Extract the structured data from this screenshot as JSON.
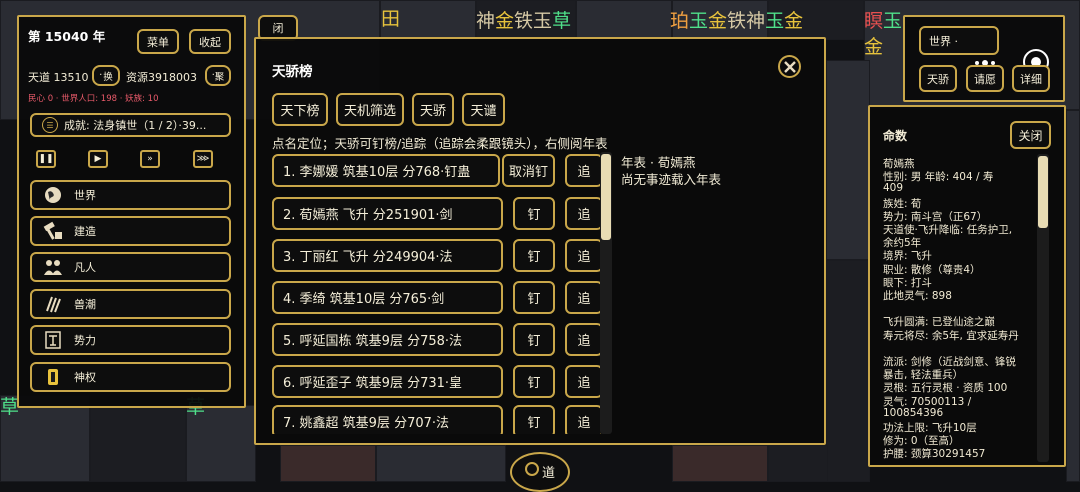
{
  "map": {
    "glyph_rows": [
      {
        "text": "神金铁玉草",
        "colors": [
          "#d5c8a4",
          "#e6c23c",
          "#d5c8a4",
          "#d5c8a4",
          "#4fe08a"
        ]
      },
      {
        "text": "珀玉金铁神玉金",
        "colors": [
          "#f0a040",
          "#4fe08a",
          "#e6c23c",
          "#d5c8a4",
          "#d5c8a4",
          "#4fe08a",
          "#e6c23c"
        ]
      },
      {
        "text": "田",
        "colors": [
          "#e6c23c"
        ]
      },
      {
        "text": "瞑玉",
        "colors": [
          "#e85050",
          "#4fe08a"
        ]
      },
      {
        "text": "金",
        "colors": [
          "#e6c23c"
        ]
      },
      {
        "text": "草",
        "colors": [
          "#4fe08a"
        ]
      }
    ],
    "colors": {
      "accent": "#c9a74a",
      "text": "#f2ecd6",
      "warn": "#e85a6a"
    }
  },
  "left_panel": {
    "year": "第 15040 年",
    "menu_label": "菜单",
    "collapse_label": "收起",
    "tiandao_label": "天道 13510",
    "swap_label": "换",
    "resources_label": "资源3918003",
    "gather_label": "聚",
    "status_line": "民心 0 · 世界人口: 198 · 妖族: 10",
    "achievement": "成就: 法身镇世（1 / 2）·39...",
    "controls": [
      {
        "icon": "pause-icon",
        "glyph": "❚❚"
      },
      {
        "icon": "play-icon",
        "glyph": "▶"
      },
      {
        "icon": "fast-forward-icon",
        "glyph": "»"
      },
      {
        "icon": "fastest-forward-icon",
        "glyph": "⋙"
      }
    ],
    "nav": [
      {
        "label": "世界",
        "icon": "globe-icon"
      },
      {
        "label": "建造",
        "icon": "hammer-icon"
      },
      {
        "label": "凡人",
        "icon": "people-icon"
      },
      {
        "label": "兽潮",
        "icon": "claw-icon"
      },
      {
        "label": "势力",
        "icon": "banner-icon"
      },
      {
        "label": "神权",
        "icon": "scroll-icon"
      }
    ]
  },
  "modal": {
    "title": "天骄榜",
    "tabs": [
      "天下榜",
      "天机筛选",
      "天骄",
      "天谴"
    ],
    "hint": "点名定位；天骄可钉榜/追踪（追踪会柔跟镜头），右侧阅年表",
    "rows": [
      {
        "text": "1. 李娜媛  筑基10层  分768·钉蛊",
        "pin": "取消钉",
        "track": "追"
      },
      {
        "text": "2. 荀嫣燕  飞升  分251901·剑",
        "pin": "钉",
        "track": "追"
      },
      {
        "text": "3. 丁丽红  飞升  分249904·法",
        "pin": "钉",
        "track": "追"
      },
      {
        "text": "4. 季绮  筑基10层  分765·剑",
        "pin": "钉",
        "track": "追"
      },
      {
        "text": "5. 呼延国栋  筑基9层  分758·法",
        "pin": "钉",
        "track": "追"
      },
      {
        "text": "6. 呼延歪子  筑基9层  分731·皇",
        "pin": "钉",
        "track": "追"
      },
      {
        "text": "7. 姚鑫超  筑基9层  分707·法",
        "pin": "钉",
        "track": "追"
      }
    ],
    "annals_title": "年表 · 荀嫣燕",
    "annals_body": "尚无事迹载入年表",
    "bottom_button": "道"
  },
  "top_right": {
    "world_select": "世界 ·",
    "buttons": [
      "天骄",
      "请愿",
      "详细"
    ]
  },
  "info_panel": {
    "title": "命数",
    "close_label": "关闭",
    "lines": [
      "荀嫣燕",
      "性别: 男   年龄: 404 / 寿",
      "409",
      "族姓: 荀",
      "势力: 南斗宫（正67）",
      "天道使·飞升降临: 任务护卫,",
      "余约5年",
      "境界: 飞升",
      "职业: 散修（尊贵4）",
      "眼下: 打斗",
      "此地灵气: 898",
      "",
      "飞升圆满: 已登仙途之巅",
      "寿元将尽: 余5年, 宜求延寿丹",
      "",
      "流派: 剑修（近战剑意、锋锐",
      "暴击, 轻法重兵）",
      "灵根: 五行灵根 · 资质 100",
      "灵气: 70500113 /",
      "100854396",
      "功法上限: 飞升10层",
      "修为: 0（至高）",
      "护腰: 颈算30291457"
    ]
  }
}
